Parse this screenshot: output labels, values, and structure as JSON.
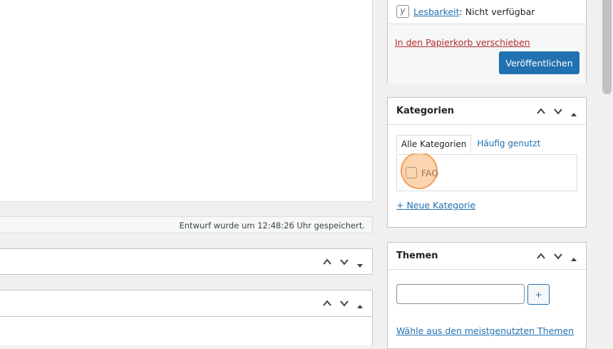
{
  "publish": {
    "readability_label": "Lesbarkeit",
    "readability_value": ": Nicht verfügbar",
    "trash_label": "In den Papierkorb verschieben",
    "publish_label": "Veröffentlichen"
  },
  "editor": {
    "status_text": "Entwurf wurde um 12:48:26 Uhr gespeichert."
  },
  "categories": {
    "title": "Kategorien",
    "tabs": [
      {
        "label": "Alle Kategorien"
      },
      {
        "label": "Häufig genutzt"
      }
    ],
    "items": [
      {
        "label": "FAQ",
        "checked": false
      }
    ],
    "add_new_label": "+ Neue Kategorie"
  },
  "themes": {
    "title": "Themen",
    "input_value": "",
    "add_button_label": "+",
    "choose_link_label": "Wähle aus den meistgenutzten Themen"
  },
  "colors": {
    "primary": "#2271b1",
    "danger": "#b32d2e",
    "click_highlight": "#f6a050"
  }
}
